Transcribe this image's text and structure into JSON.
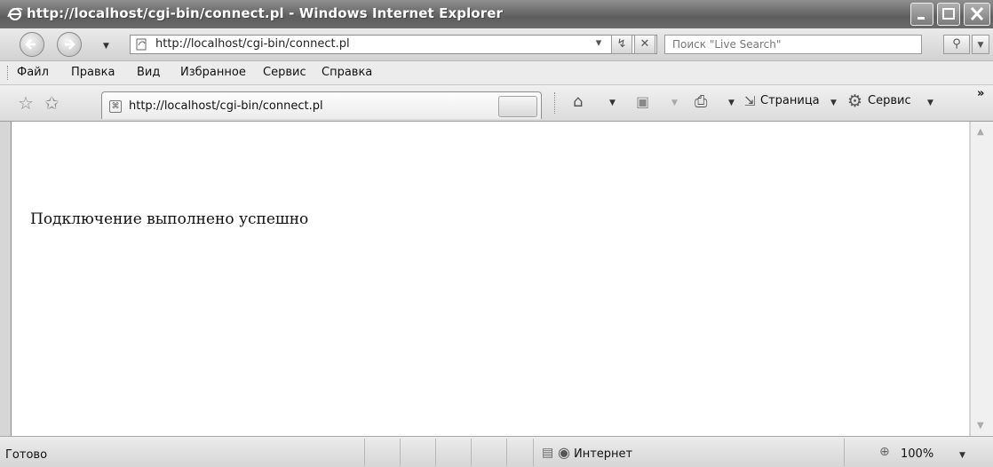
{
  "window": {
    "title": "http://localhost/cgi-bin/connect.pl - Windows Internet Explorer"
  },
  "address_bar": {
    "url": "http://localhost/cgi-bin/connect.pl"
  },
  "search": {
    "placeholder": "Поиск \"Live Search\""
  },
  "menu": {
    "items": [
      "Файл",
      "Правка",
      "Вид",
      "Избранное",
      "Сервис",
      "Справка"
    ]
  },
  "tab": {
    "label": "http://localhost/cgi-bin/connect.pl"
  },
  "command_bar": {
    "page_label": "Страница",
    "tools_label": "Сервис",
    "more": "»"
  },
  "content": {
    "message": "Подключение выполнено успешно"
  },
  "status": {
    "text": "Готово",
    "zone": "Интернет",
    "zoom": "100%"
  }
}
